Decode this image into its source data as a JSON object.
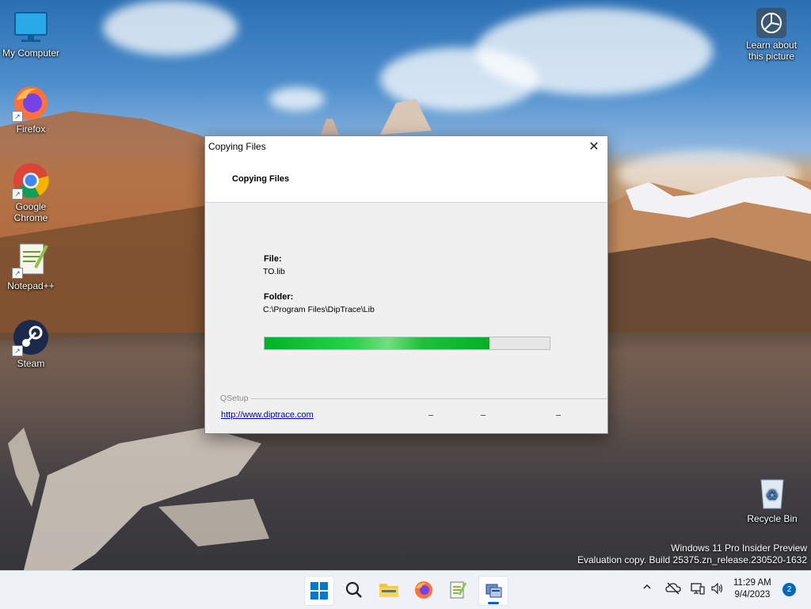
{
  "desktop": {
    "icons": [
      {
        "label": "My Computer"
      },
      {
        "label": "Firefox"
      },
      {
        "label": "Google Chrome"
      },
      {
        "label": "Notepad++"
      },
      {
        "label": "Steam"
      },
      {
        "label": "Recycle Bin"
      }
    ],
    "learn_label": "Learn about this picture"
  },
  "dialog": {
    "window_title": "Copying Files",
    "header_title": "Copying Files",
    "file_label": "File:",
    "file_value": "TO.lib",
    "folder_label": "Folder:",
    "folder_value": "C:\\Program Files\\DipTrace\\Lib",
    "progress_percent": 79,
    "brand": "QSetup",
    "link": "http://www.diptrace.com",
    "close_glyph": "✕"
  },
  "watermark": {
    "line1": "Windows 11 Pro Insider Preview",
    "line2": "Evaluation copy. Build 25375.zn_release.230520-1632"
  },
  "taskbar": {
    "items": [
      "start-icon",
      "search-icon",
      "file-explorer-icon",
      "firefox-icon",
      "notepad-plus-plus-icon",
      "setup-app-icon"
    ],
    "clock_time": "11:29 AM",
    "clock_date": "9/4/2023",
    "notification_count": "2",
    "accent": "#0067c0"
  }
}
